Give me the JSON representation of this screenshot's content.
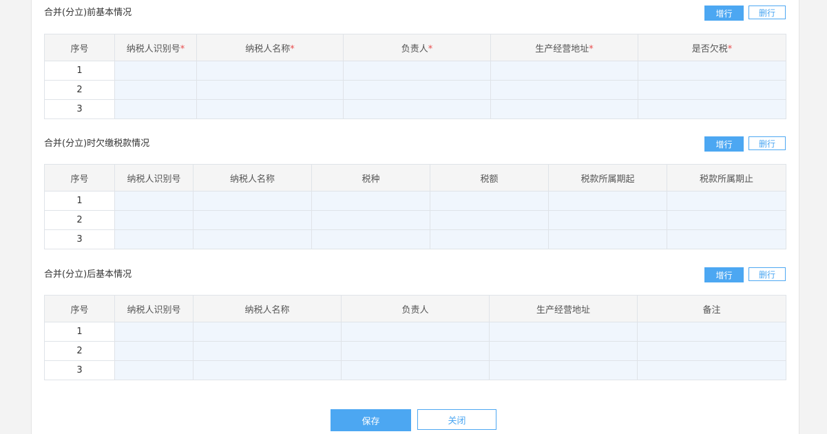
{
  "sections": [
    {
      "title": "合并(分立)前基本情况",
      "add_label": "增行",
      "del_label": "删行",
      "columns": [
        "序号",
        "纳税人识别号",
        "纳税人名称",
        "负责人",
        "生产经营地址",
        "是否欠税"
      ],
      "required_mark": "*",
      "rows": [
        "1",
        "2",
        "3"
      ]
    },
    {
      "title": "合并(分立)时欠缴税款情况",
      "add_label": "增行",
      "del_label": "删行",
      "columns": [
        "序号",
        "纳税人识别号",
        "纳税人名称",
        "税种",
        "税额",
        "税款所属期起",
        "税款所属期止"
      ],
      "rows": [
        "1",
        "2",
        "3"
      ]
    },
    {
      "title": "合并(分立)后基本情况",
      "add_label": "增行",
      "del_label": "删行",
      "columns": [
        "序号",
        "纳税人识别号",
        "纳税人名称",
        "负责人",
        "生产经营地址",
        "备注"
      ],
      "rows": [
        "1",
        "2",
        "3"
      ]
    }
  ],
  "footer": {
    "save_label": "保存",
    "close_label": "关闭"
  },
  "colors": {
    "accent": "#4ca7f2",
    "cell_fill": "#f0f6fd",
    "required": "#e84d4d"
  }
}
